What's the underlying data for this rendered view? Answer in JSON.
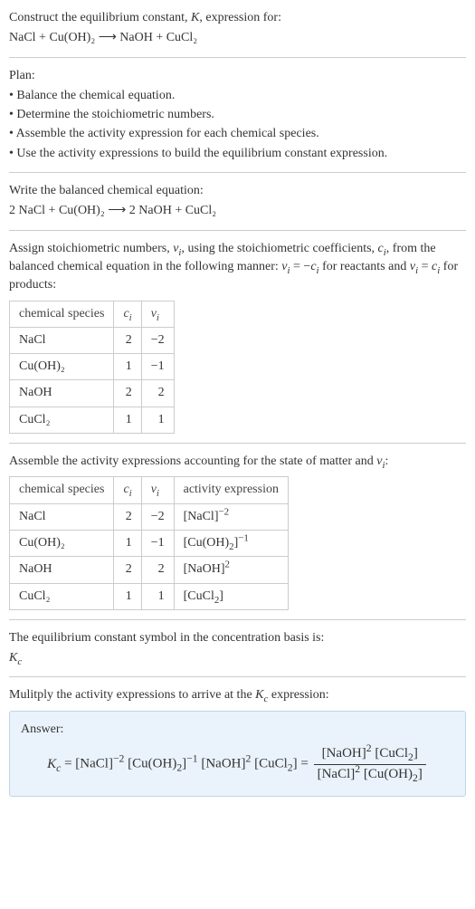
{
  "intro": {
    "line1_pre": "Construct the equilibrium constant, ",
    "line1_post": ", expression for:",
    "equation": "NaCl + Cu(OH)₂  ⟶  NaOH + CuCl₂"
  },
  "plan": {
    "heading": "Plan:",
    "items": [
      "• Balance the chemical equation.",
      "• Determine the stoichiometric numbers.",
      "• Assemble the activity expression for each chemical species.",
      "• Use the activity expressions to build the equilibrium constant expression."
    ]
  },
  "balanced": {
    "heading": "Write the balanced chemical equation:",
    "equation": "2 NaCl + Cu(OH)₂  ⟶  2 NaOH + CuCl₂"
  },
  "stoich": {
    "para_a": "Assign stoichiometric numbers, ",
    "para_b": ", using the stoichiometric coefficients, ",
    "para_c": ", from the balanced chemical equation in the following manner: ",
    "para_d": " for reactants and ",
    "para_e": " for products:",
    "table": {
      "headers": {
        "species": "chemical species"
      },
      "rows": [
        {
          "species": "NaCl",
          "c": "2",
          "v": "−2"
        },
        {
          "species": "Cu(OH)₂",
          "c": "1",
          "v": "−1"
        },
        {
          "species": "NaOH",
          "c": "2",
          "v": "2"
        },
        {
          "species": "CuCl₂",
          "c": "1",
          "v": "1"
        }
      ]
    }
  },
  "activity": {
    "para_a": "Assemble the activity expressions accounting for the state of matter and ",
    "para_b": ":",
    "table": {
      "headers": {
        "species": "chemical species",
        "expr": "activity expression"
      },
      "rows": [
        {
          "species": "NaCl",
          "c": "2",
          "v": "−2"
        },
        {
          "species": "Cu(OH)₂",
          "c": "1",
          "v": "−1"
        },
        {
          "species": "NaOH",
          "c": "2",
          "v": "2"
        },
        {
          "species": "CuCl₂",
          "c": "1",
          "v": "1"
        }
      ]
    }
  },
  "kc_symbol": {
    "line": "The equilibrium constant symbol in the concentration basis is:"
  },
  "multiply": {
    "line_a": "Mulitply the activity expressions to arrive at the ",
    "line_b": " expression:"
  },
  "answer": {
    "label": "Answer:"
  },
  "chart_data": {
    "type": "table",
    "tables": [
      {
        "title": "Stoichiometric numbers",
        "columns": [
          "chemical species",
          "c_i",
          "ν_i"
        ],
        "rows": [
          [
            "NaCl",
            2,
            -2
          ],
          [
            "Cu(OH)2",
            1,
            -1
          ],
          [
            "NaOH",
            2,
            2
          ],
          [
            "CuCl2",
            1,
            1
          ]
        ]
      },
      {
        "title": "Activity expressions",
        "columns": [
          "chemical species",
          "c_i",
          "ν_i",
          "activity expression"
        ],
        "rows": [
          [
            "NaCl",
            2,
            -2,
            "[NaCl]^-2"
          ],
          [
            "Cu(OH)2",
            1,
            -1,
            "[Cu(OH)2]^-1"
          ],
          [
            "NaOH",
            2,
            2,
            "[NaOH]^2"
          ],
          [
            "CuCl2",
            1,
            1,
            "[CuCl2]"
          ]
        ]
      }
    ]
  }
}
